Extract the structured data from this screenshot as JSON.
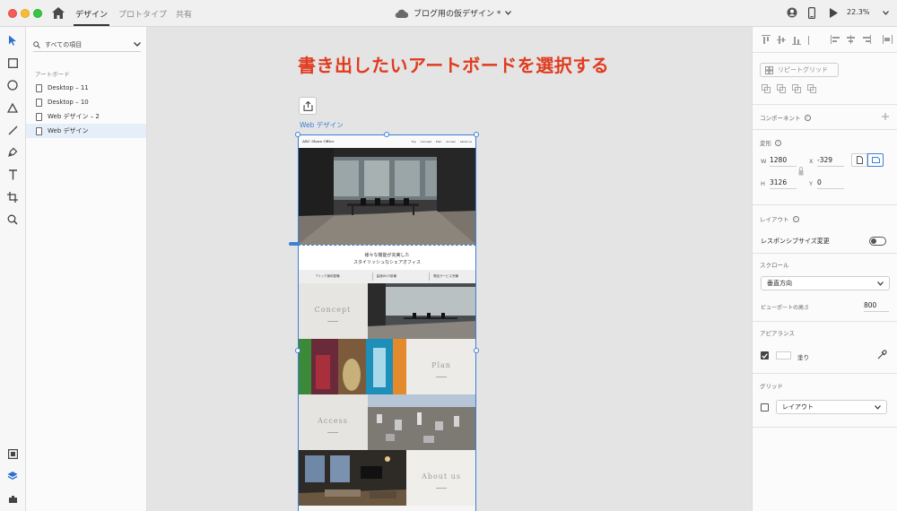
{
  "titlebar": {
    "tabs": [
      "デザイン",
      "プロトタイプ",
      "共有"
    ],
    "document_title": "ブログ用の仮デザイン *",
    "zoom": "22.3%"
  },
  "layers": {
    "search_label": "すべての項目",
    "section": "アートボード",
    "items": [
      "Desktop – 11",
      "Desktop – 10",
      "Web デザイン – 2",
      "Web デザイン"
    ]
  },
  "canvas": {
    "annotation": "書き出したいアートボードを選択する",
    "artboard_label": "Web デザイン",
    "artboard": {
      "logo": "ABC Share Office",
      "menu": [
        "Top",
        "Concept",
        "Plan",
        "Access",
        "About us"
      ],
      "tagline": [
        "様々な機能が充実した",
        "スタイリッシュなシェアオフィス"
      ],
      "features": [
        "Tリック無料配備",
        "高速Wi-Fi設備",
        "電話サービス完備"
      ],
      "tiles": [
        "Concept",
        "Plan",
        "Access",
        "About us"
      ]
    }
  },
  "props": {
    "repeat_grid": "リピートグリッド",
    "component": "コンポーネント",
    "transform": "変形",
    "w_label": "W",
    "w_value": "1280",
    "x_label": "X",
    "x_value": "-329",
    "h_label": "H",
    "h_value": "3126",
    "y_label": "Y",
    "y_value": "0",
    "layout": "レイアウト",
    "responsive": "レスポンシブサイズ変更",
    "scroll": "スクロール",
    "scroll_value": "垂直方向",
    "viewport_label": "ビューポートの高さ",
    "viewport_value": "800",
    "appearance": "アピアランス",
    "fill_label": "塗り",
    "grid": "グリッド",
    "grid_value": "レイアウト"
  },
  "colors": {
    "accent": "#3d7fd6",
    "annotation": "#e03b1e"
  }
}
